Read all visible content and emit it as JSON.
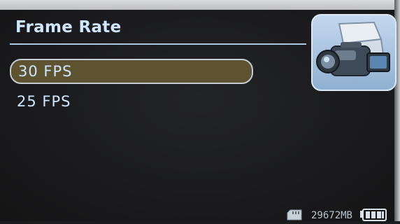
{
  "menu": {
    "title": "Frame Rate",
    "items": [
      {
        "label": "30 FPS",
        "selected": true
      },
      {
        "label": "25 FPS",
        "selected": false
      }
    ]
  },
  "status_bar": {
    "storage": "29672MB",
    "icons": [
      "sd-card-icon",
      "battery-icon"
    ]
  },
  "header_icon": "video-camera-icon",
  "colors": {
    "text": "#cfe6ff",
    "highlight_fill": "#5d5330",
    "highlight_border": "#c4cdd6",
    "background": "#1b1c1e",
    "icon_tile": "#a9c4e2"
  }
}
